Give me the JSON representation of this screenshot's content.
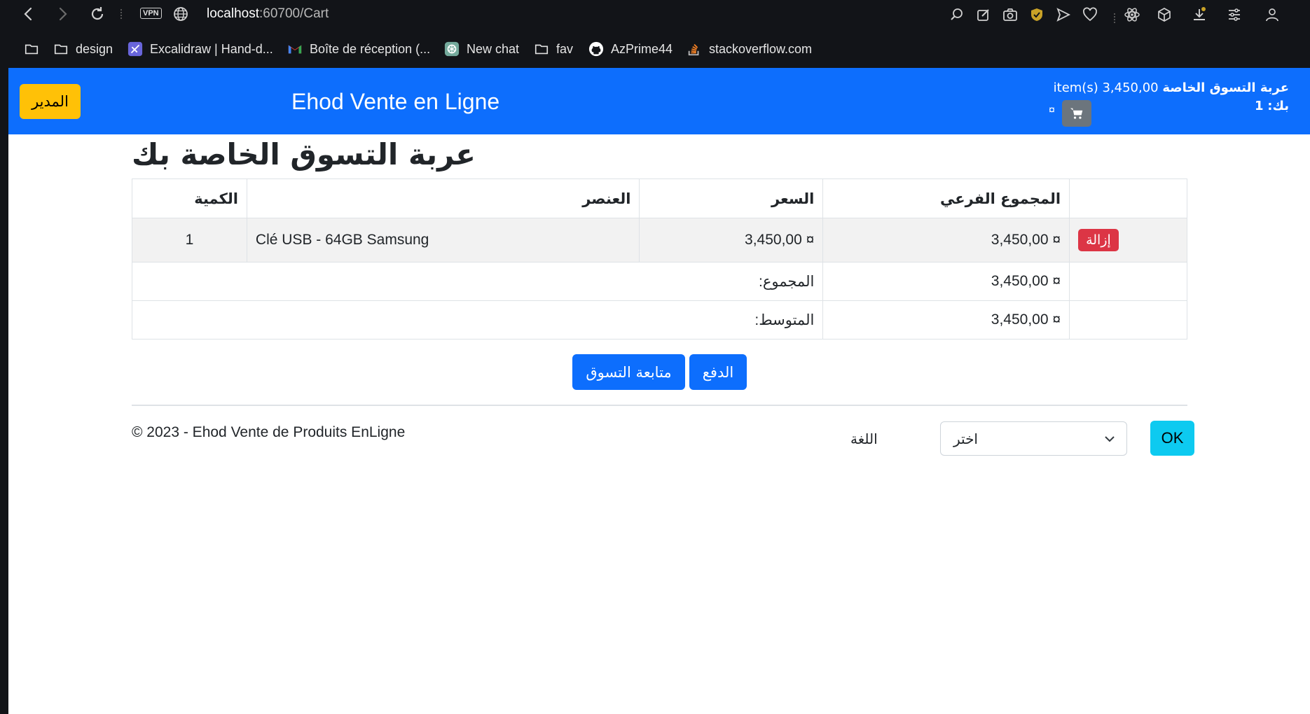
{
  "browser": {
    "vpn_label": "VPN",
    "url_host": "localhost",
    "url_path": ":60700/Cart",
    "bookmarks": [
      {
        "label": "",
        "icon": "folder-icon"
      },
      {
        "label": "design",
        "icon": "folder-icon"
      },
      {
        "label": "Excalidraw | Hand-d...",
        "icon": "excalidraw-icon"
      },
      {
        "label": "Boîte de réception (...",
        "icon": "gmail-icon"
      },
      {
        "label": "New chat",
        "icon": "chatgpt-icon"
      },
      {
        "label": "fav",
        "icon": "folder-icon"
      },
      {
        "label": "AzPrime44",
        "icon": "github-icon"
      },
      {
        "label": "stackoverflow.com",
        "icon": "stackoverflow-icon"
      }
    ]
  },
  "navbar": {
    "admin_label": "المدير",
    "brand": "Ehod Vente en Ligne",
    "cart_summary_label": "عربة التسوق الخاصة بك:",
    "cart_summary_count": "1",
    "cart_summary_items": "item(s) 3,450,00",
    "currency_sign": "¤"
  },
  "page": {
    "title": "عربة التسوق الخاصة بك"
  },
  "cart_table": {
    "headers": {
      "quantity": "الكمية",
      "item": "العنصر",
      "price": "السعر",
      "subtotal": "المجموع الفرعي"
    },
    "rows": [
      {
        "quantity": "1",
        "item": "Clé USB - 64GB Samsung",
        "price": "3,450,00 ¤",
        "subtotal": "3,450,00 ¤",
        "remove_label": "إزالة"
      }
    ],
    "total_label": ":المجموع",
    "total_value": "3,450,00 ¤",
    "average_label": ":المتوسط",
    "average_value": "3,450,00 ¤"
  },
  "actions": {
    "continue_label": "متابعة التسوق",
    "checkout_label": "الدفع"
  },
  "footer": {
    "copyright": "© 2023 - Ehod Vente de Produits EnLigne",
    "language_label": "اللغة",
    "language_selected": "اختر",
    "ok_label": "OK"
  },
  "colors": {
    "primary": "#0d6efd",
    "warning": "#ffc107",
    "danger": "#dc3545",
    "info": "#0dcaf0",
    "secondary": "#6c757d"
  }
}
